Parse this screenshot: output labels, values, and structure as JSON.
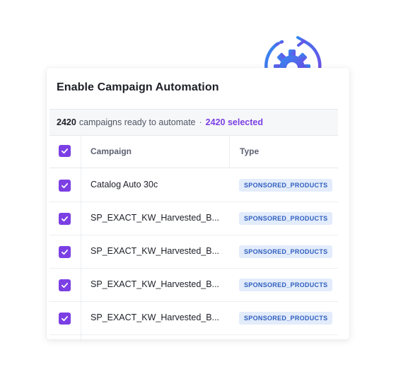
{
  "dialog": {
    "title": "Enable Campaign Automation"
  },
  "summary": {
    "count": "2420",
    "text": "campaigns ready to automate",
    "separator": "·",
    "selected": "2420 selected"
  },
  "table": {
    "columns": [
      "Campaign",
      "Type"
    ],
    "rows": [
      {
        "campaign": "Catalog Auto 30c",
        "type": "SPONSORED_PRODUCTS",
        "checked": true
      },
      {
        "campaign": "SP_EXACT_KW_Harvested_B...",
        "type": "SPONSORED_PRODUCTS",
        "checked": true
      },
      {
        "campaign": "SP_EXACT_KW_Harvested_B...",
        "type": "SPONSORED_PRODUCTS",
        "checked": true
      },
      {
        "campaign": "SP_EXACT_KW_Harvested_B...",
        "type": "SPONSORED_PRODUCTS",
        "checked": true
      },
      {
        "campaign": "SP_EXACT_KW_Harvested_B...",
        "type": "SPONSORED_PRODUCTS",
        "checked": true
      }
    ],
    "header_checked": true
  },
  "icons": {
    "automation": "gear-refresh-icon",
    "checkbox": "checkmark-icon"
  },
  "colors": {
    "accent_purple": "#7b3fe4",
    "badge_bg": "#e3ecfb",
    "badge_text": "#2f5fbf",
    "gear_gradient_start": "#2f8cf0",
    "gear_gradient_end": "#7b3fe4"
  }
}
